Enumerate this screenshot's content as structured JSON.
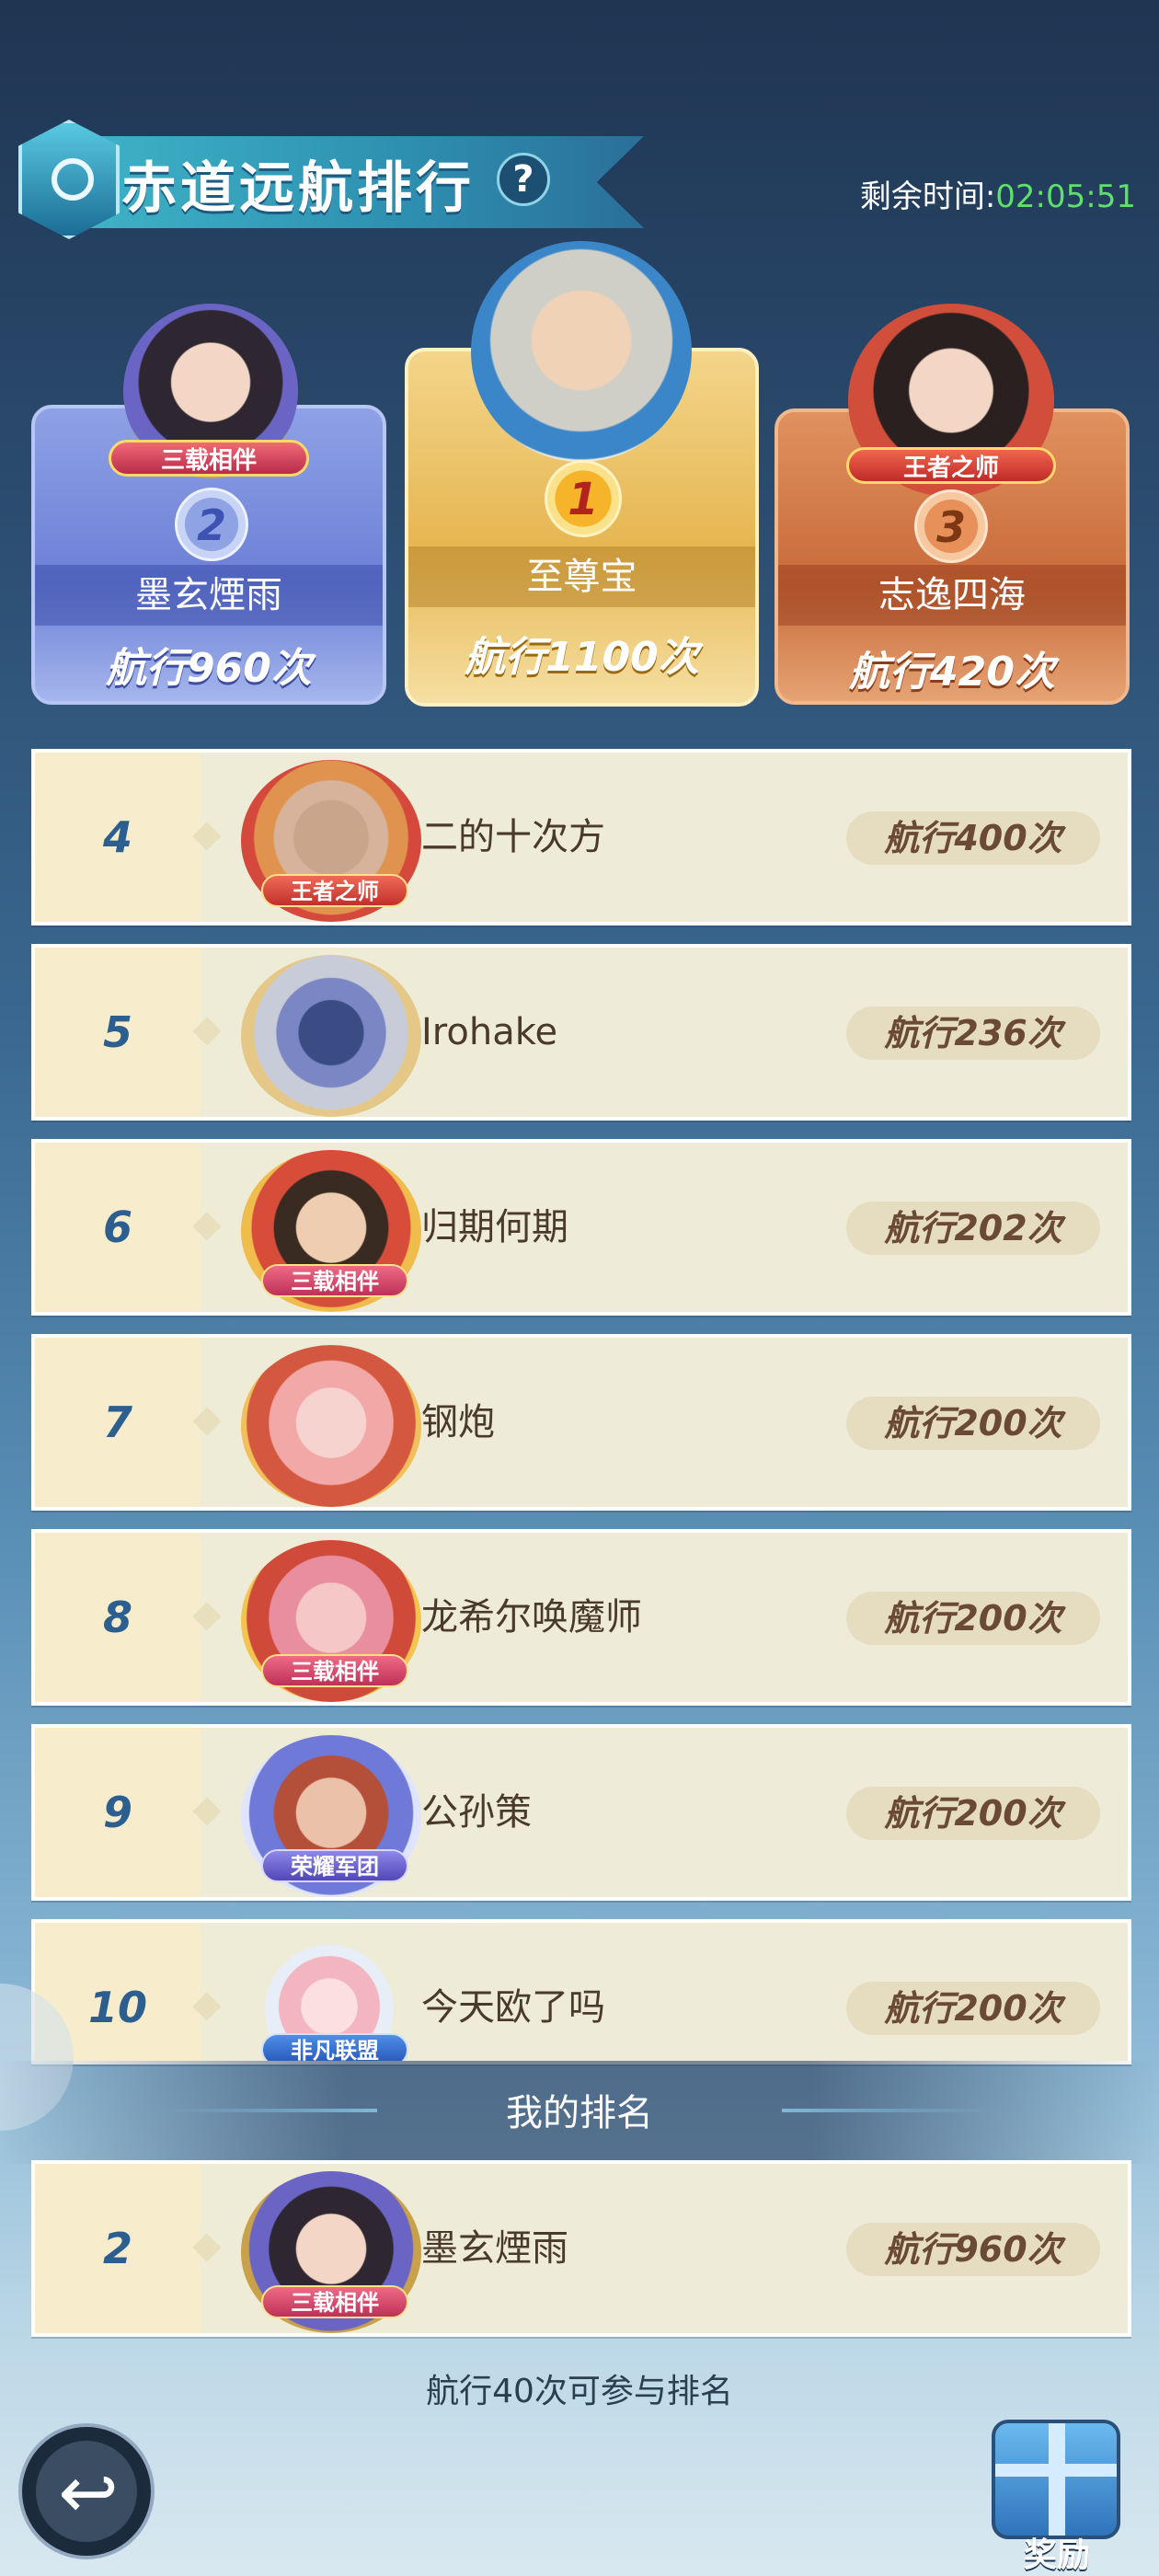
{
  "header": {
    "title": "赤道远航排行",
    "help_glyph": "?",
    "timer_label": "剩余时间:",
    "timer_value": "02:05:51"
  },
  "podium": [
    {
      "rank": "2",
      "name": "墨玄煙雨",
      "score": "航行960次",
      "tag": "三载相伴"
    },
    {
      "rank": "1",
      "name": "至尊宝",
      "score": "航行1100次",
      "tag": ""
    },
    {
      "rank": "3",
      "name": "志逸四海",
      "score": "航行420次",
      "tag": "王者之师"
    }
  ],
  "rows": [
    {
      "rank": "4",
      "name": "二的十次方",
      "score": "航行400次",
      "tag": "王者之师"
    },
    {
      "rank": "5",
      "name": "Irohake",
      "score": "航行236次",
      "tag": ""
    },
    {
      "rank": "6",
      "name": "归期何期",
      "score": "航行202次",
      "tag": "三载相伴"
    },
    {
      "rank": "7",
      "name": "钢炮",
      "score": "航行200次",
      "tag": ""
    },
    {
      "rank": "8",
      "name": "龙希尔唤魔师",
      "score": "航行200次",
      "tag": "三载相伴"
    },
    {
      "rank": "9",
      "name": "公孙策",
      "score": "航行200次",
      "tag": "荣耀军团"
    },
    {
      "rank": "10",
      "name": "今天欧了吗",
      "score": "航行200次",
      "tag": "非凡联盟"
    }
  ],
  "my_rank": {
    "title": "我的排名",
    "rank": "2",
    "name": "墨玄煙雨",
    "score": "航行960次",
    "tag": "三载相伴"
  },
  "hint": "航行40次可参与排名",
  "buttons": {
    "back_icon": "back-arrow-icon",
    "back_glyph": "↩",
    "reward_icon": "gift-icon",
    "reward_label": "奖励"
  }
}
